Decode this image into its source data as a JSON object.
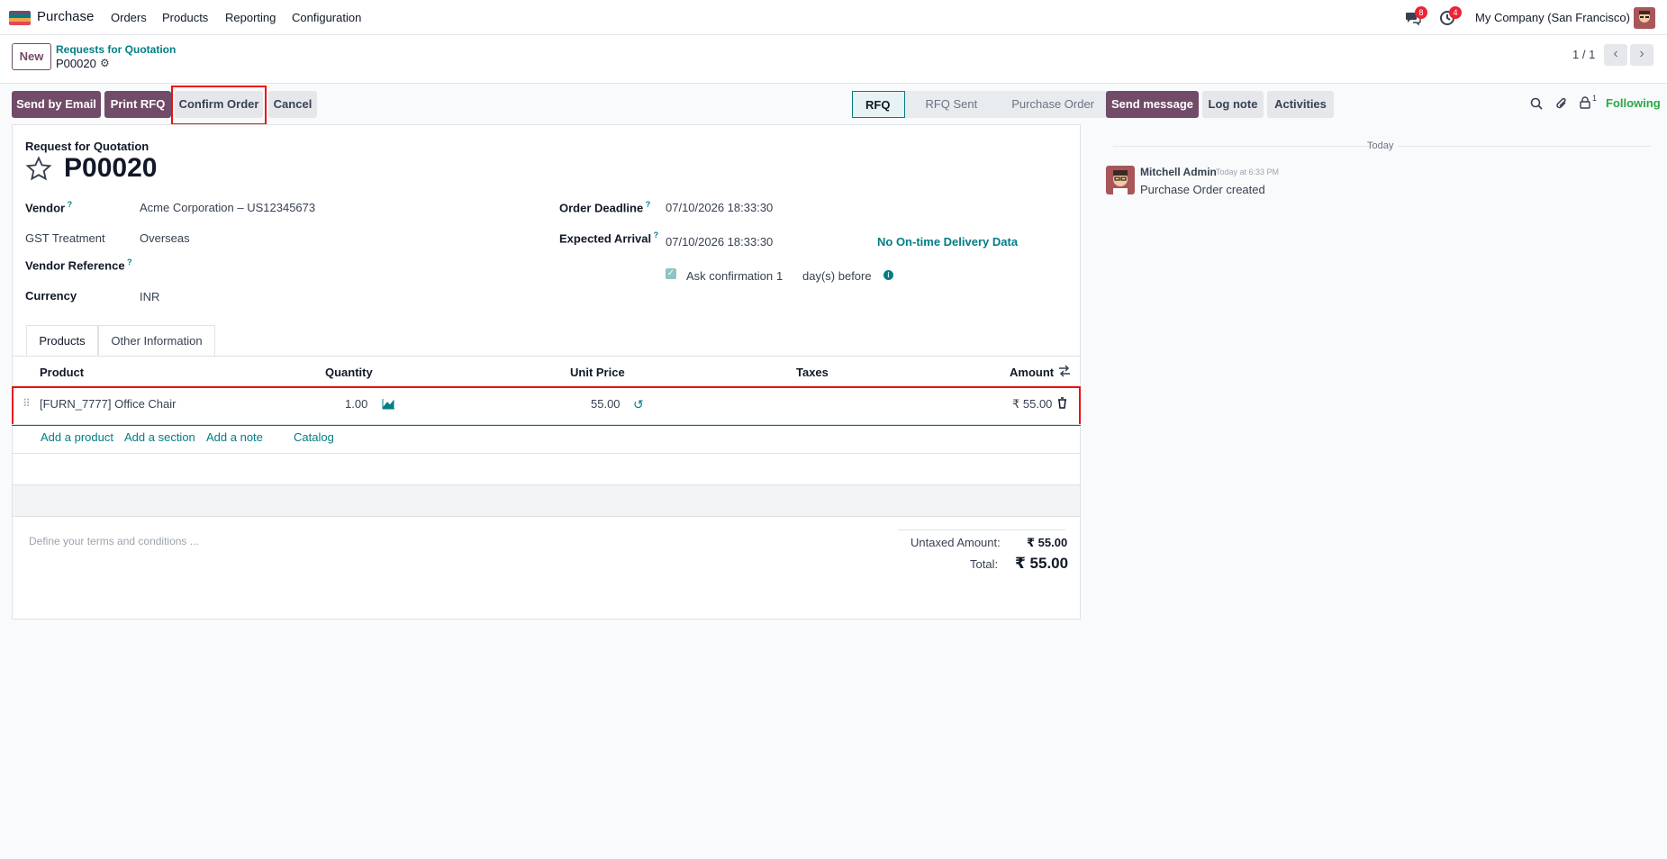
{
  "navbar": {
    "app_name": "Purchase",
    "menu": [
      "Orders",
      "Products",
      "Reporting",
      "Configuration"
    ],
    "messages_badge": "8",
    "activities_badge": "4",
    "company": "My Company (San Francisco)",
    "logo_colors": [
      "#714b67",
      "#017e84",
      "#f0a44b",
      "#e8474f"
    ]
  },
  "control": {
    "new_label": "New",
    "breadcrumb_parent": "Requests for Quotation",
    "breadcrumb_current": "P00020",
    "pager": "1 / 1"
  },
  "actions": {
    "send_email": "Send by Email",
    "print_rfq": "Print RFQ",
    "confirm_order": "Confirm Order",
    "cancel": "Cancel"
  },
  "statusbar": [
    "RFQ",
    "RFQ Sent",
    "Purchase Order"
  ],
  "form": {
    "doc_type": "Request for Quotation",
    "name": "P00020",
    "vendor_label": "Vendor",
    "vendor_value": "Acme Corporation – US12345673",
    "gst_label": "GST Treatment",
    "gst_value": "Overseas",
    "vendor_ref_label": "Vendor Reference",
    "currency_label": "Currency",
    "currency_value": "INR",
    "deadline_label": "Order Deadline",
    "deadline_value": "07/10/2026 18:33:30",
    "arrival_label": "Expected Arrival",
    "arrival_value": "07/10/2026 18:33:30",
    "ontime_link": "No On-time Delivery Data",
    "ask_confirmation": "Ask confirmation",
    "ask_days": "1",
    "days_before": "day(s) before"
  },
  "tabs": [
    "Products",
    "Other Information"
  ],
  "table": {
    "headers": {
      "product": "Product",
      "quantity": "Quantity",
      "unit_price": "Unit Price",
      "taxes": "Taxes",
      "amount": "Amount"
    },
    "rows": [
      {
        "product": "[FURN_7777] Office Chair",
        "quantity": "1.00",
        "unit_price": "55.00",
        "taxes": "",
        "amount": "₹ 55.00"
      }
    ],
    "add_product": "Add a product",
    "add_section": "Add a section",
    "add_note": "Add a note",
    "catalog": "Catalog"
  },
  "footer": {
    "terms_placeholder": "Define your terms and conditions ...",
    "untaxed_label": "Untaxed Amount:",
    "untaxed_value": "₹ 55.00",
    "total_label": "Total:",
    "total_value": "₹ 55.00"
  },
  "chatter": {
    "send_message": "Send message",
    "log_note": "Log note",
    "activities": "Activities",
    "followers_count": "1",
    "following": "Following",
    "date_separator": "Today",
    "author": "Mitchell Admin",
    "timestamp": "Today at 6:33 PM",
    "message": "Purchase Order created"
  }
}
